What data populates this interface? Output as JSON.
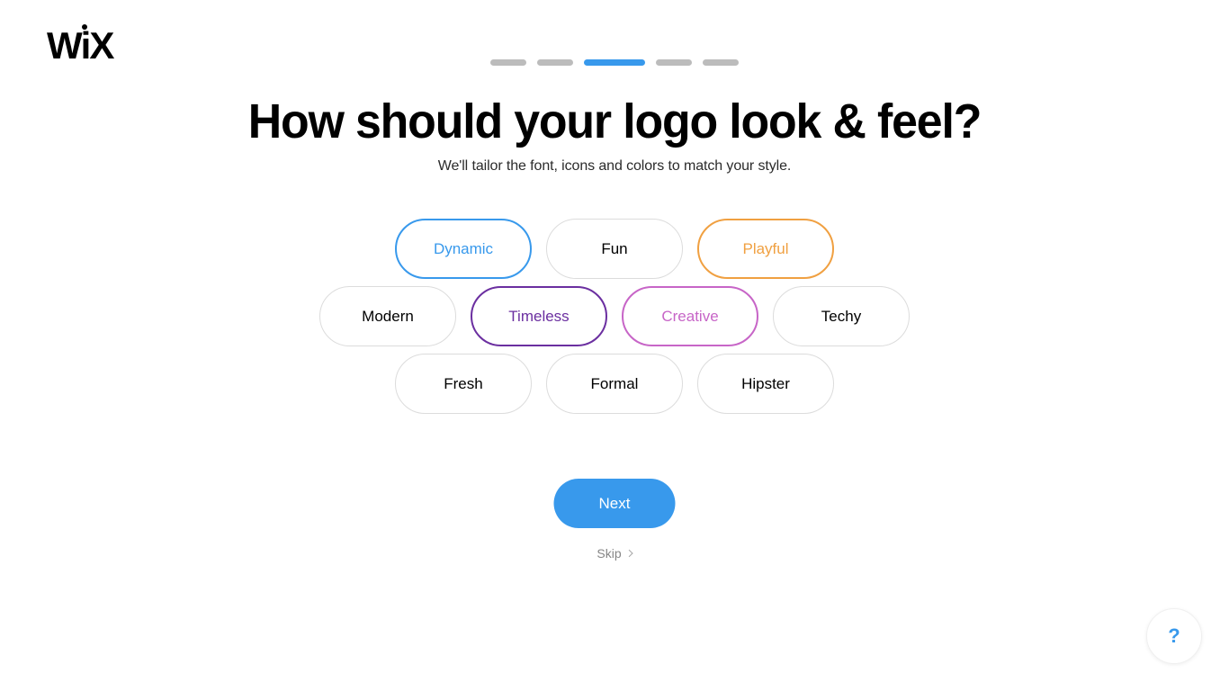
{
  "brand": {
    "logo_text": "WiX",
    "logo_part1": "W",
    "logo_part2": "i",
    "logo_part3": "X"
  },
  "progress": {
    "total_steps": 5,
    "current_step": 3,
    "segments": [
      {
        "state": "inactive"
      },
      {
        "state": "inactive"
      },
      {
        "state": "active"
      },
      {
        "state": "inactive"
      },
      {
        "state": "inactive"
      }
    ]
  },
  "header": {
    "title": "How should your logo look & feel?",
    "subtitle": "We'll tailor the font, icons and colors to match your style."
  },
  "chips": {
    "rows": [
      [
        {
          "label": "Dynamic",
          "selected": true,
          "color": "#3899ec"
        },
        {
          "label": "Fun",
          "selected": false,
          "color": "#000000"
        },
        {
          "label": "Playful",
          "selected": true,
          "color": "#f0a041"
        }
      ],
      [
        {
          "label": "Modern",
          "selected": false,
          "color": "#000000"
        },
        {
          "label": "Timeless",
          "selected": true,
          "color": "#6b2fa0"
        },
        {
          "label": "Creative",
          "selected": true,
          "color": "#c765c7"
        },
        {
          "label": "Techy",
          "selected": false,
          "color": "#000000"
        }
      ],
      [
        {
          "label": "Fresh",
          "selected": false,
          "color": "#000000"
        },
        {
          "label": "Formal",
          "selected": false,
          "color": "#000000"
        },
        {
          "label": "Hipster",
          "selected": false,
          "color": "#000000"
        }
      ]
    ]
  },
  "actions": {
    "next_label": "Next",
    "skip_label": "Skip",
    "help_label": "?"
  },
  "colors": {
    "accent_blue": "#3899ec",
    "progress_inactive": "#bcbcbc",
    "chip_border": "#dcdcdc",
    "subtitle": "#2b2b2b",
    "skip": "#868686"
  }
}
